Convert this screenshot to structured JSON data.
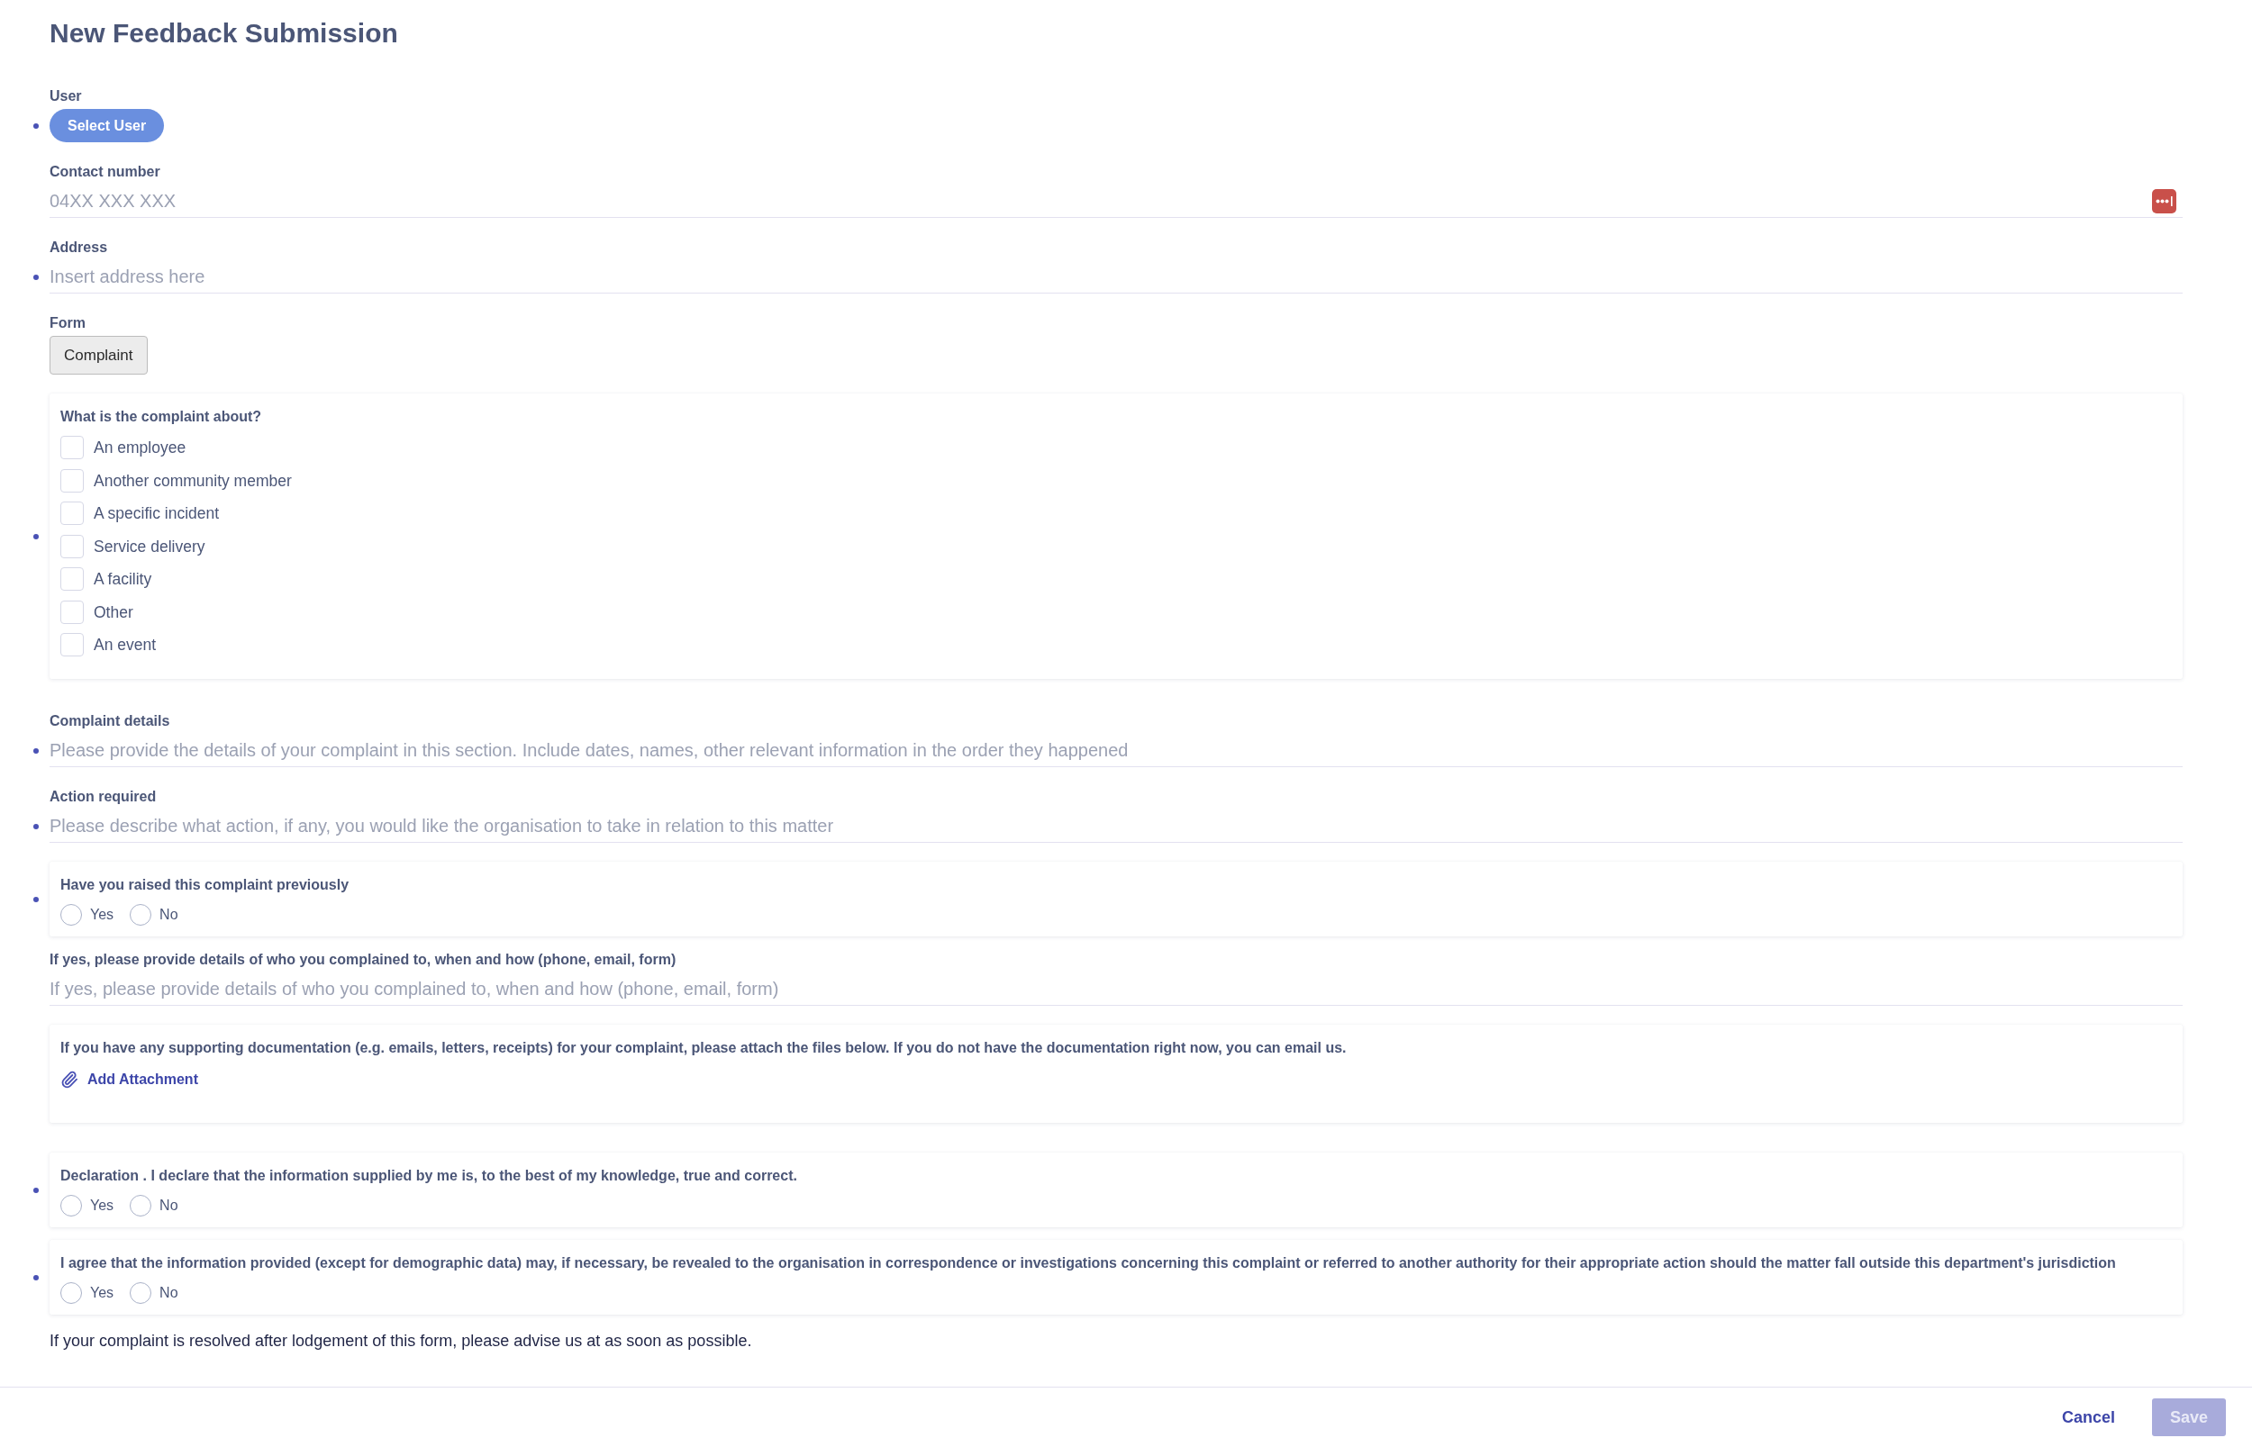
{
  "title": "New Feedback Submission",
  "fields": [
    {
      "kind": "picker",
      "label": "User",
      "required": true,
      "button": "Select User"
    },
    {
      "kind": "text",
      "label": "Contact number",
      "required": false,
      "placeholder": "04XX XXX XXX",
      "autofill_icon": true
    },
    {
      "kind": "text",
      "label": "Address",
      "required": true,
      "placeholder": "Insert address here",
      "autofill_icon": false
    },
    {
      "kind": "choice",
      "label": "Form",
      "required": false,
      "value": "Complaint"
    },
    {
      "kind": "checklist",
      "required": true,
      "question": "What is the complaint about?",
      "options": [
        {
          "label": "An employee",
          "checked": false
        },
        {
          "label": "Another community member",
          "checked": false
        },
        {
          "label": "A specific incident",
          "checked": false
        },
        {
          "label": "Service delivery",
          "checked": false
        },
        {
          "label": "A facility",
          "checked": false
        },
        {
          "label": "Other",
          "checked": false
        },
        {
          "label": "An event",
          "checked": false
        }
      ]
    },
    {
      "kind": "text",
      "label": "Complaint details",
      "required": true,
      "placeholder": "Please provide the details of your complaint in this section. Include dates, names, other relevant information in the order they happened",
      "autofill_icon": false
    },
    {
      "kind": "text",
      "label": "Action required",
      "required": true,
      "placeholder": "Please describe what action, if any, you would like the organisation to take in relation to this matter",
      "autofill_icon": false
    },
    {
      "kind": "radio",
      "required": true,
      "question": "Have you raised this complaint previously",
      "options": [
        {
          "label": "Yes",
          "selected": false
        },
        {
          "label": "No",
          "selected": false
        }
      ]
    },
    {
      "kind": "text",
      "label": "If yes, please provide details of who you complained to, when and how (phone, email, form)",
      "required": false,
      "placeholder": "If yes, please provide details of who you complained to, when and how (phone, email, form)",
      "autofill_icon": false
    },
    {
      "kind": "attachment",
      "required": false,
      "question": "If you have any supporting documentation (e.g. emails, letters, receipts) for your complaint, please attach the files below. If you do not have the documentation right now, you can email us.",
      "link": "Add Attachment"
    },
    {
      "kind": "radio",
      "required": true,
      "question": "Declaration . I declare that the information supplied by me is, to the best of my knowledge, true and correct.",
      "options": [
        {
          "label": "Yes",
          "selected": false
        },
        {
          "label": "No",
          "selected": false
        }
      ]
    },
    {
      "kind": "radio",
      "required": true,
      "question": "I agree that the information provided (except for demographic data) may, if necessary, be revealed to the organisation in correspondence or investigations concerning this complaint or referred to another authority for their appropriate action should the matter fall outside this department's jurisdiction",
      "options": [
        {
          "label": "Yes",
          "selected": false
        },
        {
          "label": "No",
          "selected": false
        }
      ]
    }
  ],
  "note": "If your complaint is resolved after lodgement of this form, please advise us at as soon as possible.",
  "footer": {
    "buttons": [
      {
        "kind": "link",
        "label": "Cancel",
        "disabled": false
      },
      {
        "kind": "primary",
        "label": "Save",
        "disabled": true
      }
    ]
  }
}
